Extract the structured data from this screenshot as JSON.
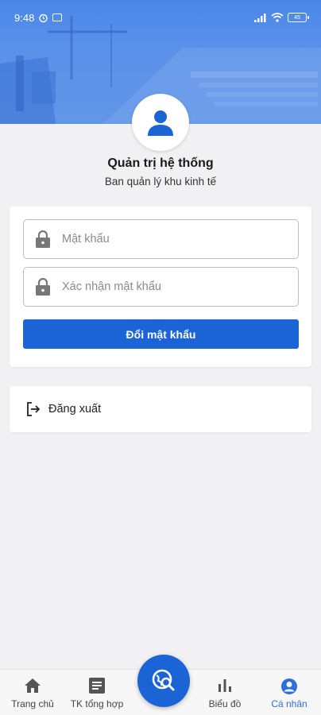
{
  "status_bar": {
    "time": "9:48",
    "battery": "45"
  },
  "profile": {
    "name": "Quản trị hệ thống",
    "organization": "Ban quản lý khu kinh tế"
  },
  "password_form": {
    "password_placeholder": "Mật khẩu",
    "confirm_placeholder": "Xác nhận mật khẩu",
    "submit_label": "Đổi mật khẩu"
  },
  "logout": {
    "label": "Đăng xuất"
  },
  "bottom_nav": {
    "items": [
      {
        "label": "Trang chủ",
        "icon": "home-icon"
      },
      {
        "label": "TK tổng hợp",
        "icon": "document-icon"
      },
      {
        "label": "Biểu đồ",
        "icon": "bar-chart-icon"
      },
      {
        "label": "Cá nhân",
        "icon": "account-icon"
      }
    ],
    "center_icon": "search-globe-icon",
    "active_index": 3
  },
  "colors": {
    "primary": "#1b64d6",
    "banner": "#4a86e8",
    "active_nav": "#2f6fdc",
    "background": "#f1f1f3"
  }
}
